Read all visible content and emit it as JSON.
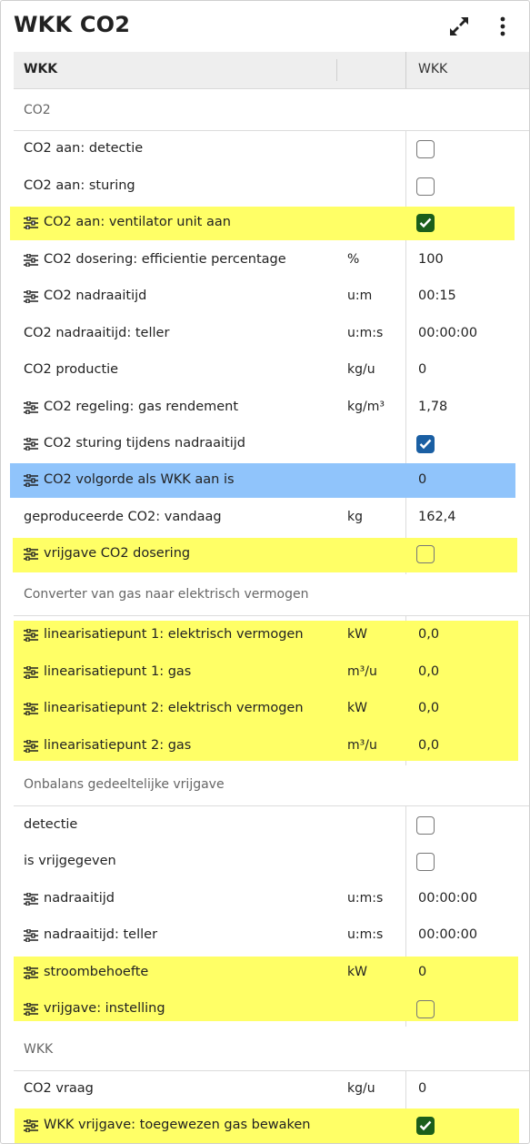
{
  "title": "WKK CO2",
  "header": {
    "icons": [
      "expand-icon",
      "more-vertical-icon"
    ],
    "col1": "WKK",
    "col2": "WKK"
  },
  "sections": {
    "co2": "CO2",
    "converter": "Converter van gas naar elektrisch vermogen",
    "onbalans": "Onbalans gedeeltelijke vrijgave",
    "wkk": "WKK"
  },
  "rows": {
    "r1": {
      "label": "CO2 aan: detectie",
      "checked": false
    },
    "r2": {
      "label": "CO2 aan: sturing",
      "checked": false
    },
    "r3": {
      "label": "CO2 aan: ventilator unit aan",
      "checked": true
    },
    "r4": {
      "label": "CO2 dosering: efficientie percentage",
      "unit": "%",
      "value": "100"
    },
    "r5": {
      "label": "CO2 nadraaitijd",
      "unit": "u:m",
      "value": "00:15"
    },
    "r6": {
      "label": "CO2 nadraaitijd: teller",
      "unit": "u:m:s",
      "value": "00:00:00"
    },
    "r7": {
      "label": "CO2 productie",
      "unit": "kg/u",
      "value": "0"
    },
    "r8": {
      "label": "CO2 regeling: gas rendement",
      "unit": "kg/m³",
      "value": "1,78"
    },
    "r9": {
      "label": "CO2 sturing tijdens nadraaitijd",
      "checked": true
    },
    "r10": {
      "label": "CO2 volgorde als WKK aan is",
      "value": "0"
    },
    "r11": {
      "label": "geproduceerde CO2: vandaag",
      "unit": "kg",
      "value": "162,4"
    },
    "r12": {
      "label": "vrijgave CO2 dosering",
      "checked": false
    },
    "r13": {
      "label": "linearisatiepunt 1: elektrisch vermogen",
      "unit": "kW",
      "value": "0,0"
    },
    "r14": {
      "label": "linearisatiepunt 1: gas",
      "unit": "m³/u",
      "value": "0,0"
    },
    "r15": {
      "label": "linearisatiepunt 2: elektrisch vermogen",
      "unit": "kW",
      "value": "0,0"
    },
    "r16": {
      "label": "linearisatiepunt 2: gas",
      "unit": "m³/u",
      "value": "0,0"
    },
    "r17": {
      "label": "detectie",
      "checked": false
    },
    "r18": {
      "label": "is vrijgegeven",
      "checked": false
    },
    "r19": {
      "label": "nadraaitijd",
      "unit": "u:m:s",
      "value": "00:00:00"
    },
    "r20": {
      "label": "nadraaitijd: teller",
      "unit": "u:m:s",
      "value": "00:00:00"
    },
    "r21": {
      "label": "stroombehoefte",
      "unit": "kW",
      "value": "0"
    },
    "r22": {
      "label": "vrijgave: instelling",
      "checked": false
    },
    "r23": {
      "label": "CO2 vraag",
      "unit": "kg/u",
      "value": "0"
    },
    "r24": {
      "label": "WKK vrijgave: toegewezen gas bewaken",
      "checked": true
    }
  },
  "colors": {
    "highlight_yellow": "#ffff66",
    "highlight_blue": "#90c4fb",
    "check_green": "#1b5e1b",
    "check_blue": "#1a5fa3"
  }
}
